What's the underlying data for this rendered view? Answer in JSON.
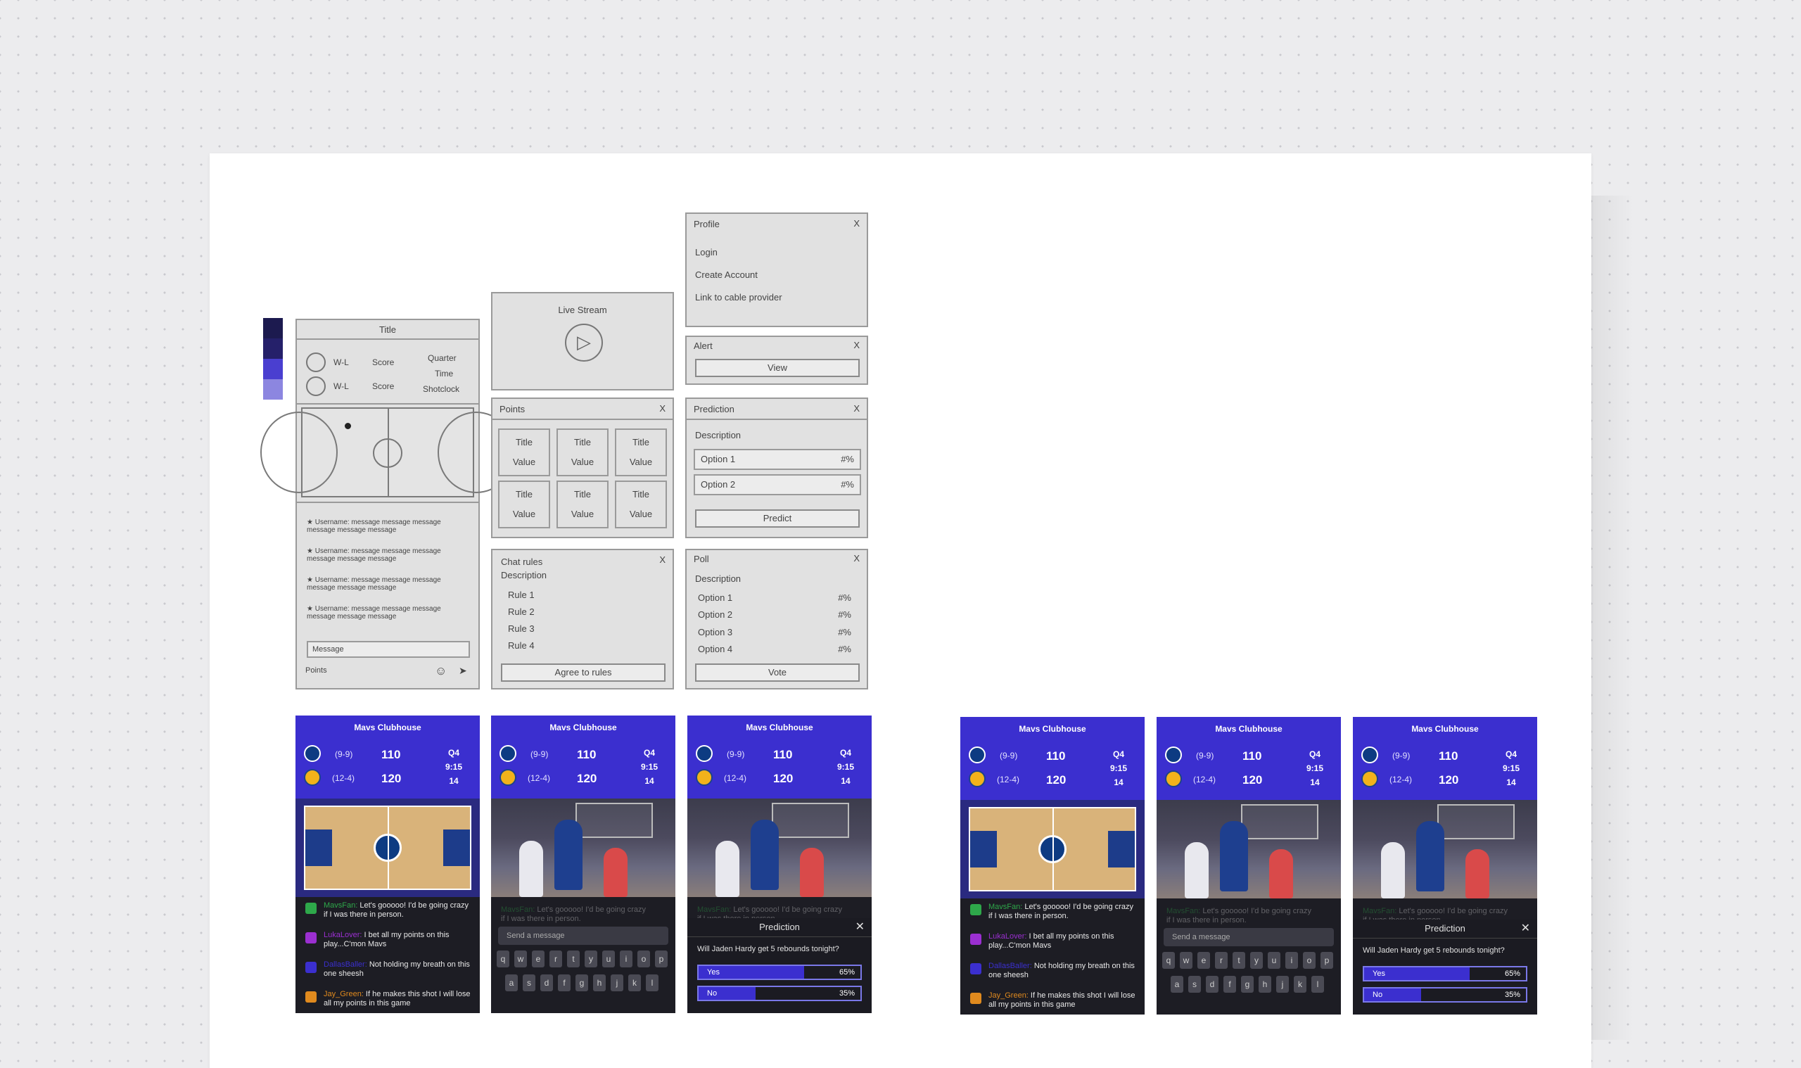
{
  "colors": {
    "swatches": [
      "#1c1a4f",
      "#25206a",
      "#4a3fd0",
      "#8c86e0"
    ],
    "brand": "#3b2fcf",
    "wireframe_bg": "#e1e1e1"
  },
  "wireframes": {
    "main": {
      "title": "Title",
      "team1": {
        "record": "W-L",
        "score": "Score"
      },
      "team2": {
        "record": "W-L",
        "score": "Score"
      },
      "game_info": [
        "Quarter",
        "Time",
        "Shotclock"
      ],
      "messages": [
        "Username: message message message message message message",
        "Username: message message message message message message",
        "Username: message message message message message message",
        "Username: message message message message message message"
      ],
      "message_placeholder": "Message",
      "points_label": "Points"
    },
    "live_stream": {
      "title": "Live Stream"
    },
    "points": {
      "title": "Points",
      "close": "X",
      "cells": [
        {
          "title": "Title",
          "value": "Value"
        },
        {
          "title": "Title",
          "value": "Value"
        },
        {
          "title": "Title",
          "value": "Value"
        },
        {
          "title": "Title",
          "value": "Value"
        },
        {
          "title": "Title",
          "value": "Value"
        },
        {
          "title": "Title",
          "value": "Value"
        }
      ]
    },
    "chat_rules": {
      "title": "Chat rules",
      "close": "X",
      "description": "Description",
      "rules": [
        "Rule 1",
        "Rule 2",
        "Rule 3",
        "Rule 4"
      ],
      "button": "Agree to rules"
    },
    "profile": {
      "title": "Profile",
      "close": "X",
      "items": [
        "Login",
        "Create Account",
        "Link to cable provider"
      ]
    },
    "alert": {
      "title": "Alert",
      "close": "X",
      "button": "View"
    },
    "prediction": {
      "title": "Prediction",
      "close": "X",
      "description": "Description",
      "options": [
        {
          "label": "Option 1",
          "pct": "#%"
        },
        {
          "label": "Option 2",
          "pct": "#%"
        }
      ],
      "button": "Predict"
    },
    "poll": {
      "title": "Poll",
      "close": "X",
      "description": "Description",
      "options": [
        {
          "label": "Option 1",
          "pct": "#%"
        },
        {
          "label": "Option 2",
          "pct": "#%"
        },
        {
          "label": "Option 3",
          "pct": "#%"
        },
        {
          "label": "Option 4",
          "pct": "#%"
        }
      ],
      "button": "Vote"
    }
  },
  "mobile": {
    "app_title": "Mavs Clubhouse",
    "team1": {
      "record": "(9-9)",
      "score": "110"
    },
    "team2": {
      "record": "(12-4)",
      "score": "120"
    },
    "quarter": "Q4",
    "clock": "9:15",
    "shotclock": "14",
    "chat": [
      {
        "user": "MavsFan",
        "text": "Let's gooooo! I'd be going crazy if I was there in person.",
        "color": "#2ea84a"
      },
      {
        "user": "LukaLover",
        "text": "I bet all my points on this play...C'mon Mavs",
        "color": "#9b2fd1"
      },
      {
        "user": "DallasBaller",
        "text": "Not holding my breath on this one sheesh",
        "color": "#3b2fcf"
      },
      {
        "user": "Jay_Green",
        "text": "If he makes this shot I will lose all my points in this game",
        "color": "#e08a1e"
      }
    ],
    "message_placeholder": "Send a message",
    "keyboard_row1": [
      "q",
      "w",
      "e",
      "r",
      "t",
      "y",
      "u",
      "i",
      "o",
      "p"
    ],
    "keyboard_row2": [
      "a",
      "s",
      "d",
      "f",
      "g",
      "h",
      "j",
      "k",
      "l"
    ],
    "prediction": {
      "title": "Prediction",
      "question": "Will Jaden Hardy get 5 rebounds tonight?",
      "options": [
        {
          "label": "Yes",
          "pct": "65%",
          "fill": 0.65
        },
        {
          "label": "No",
          "pct": "35%",
          "fill": 0.35
        }
      ]
    }
  }
}
